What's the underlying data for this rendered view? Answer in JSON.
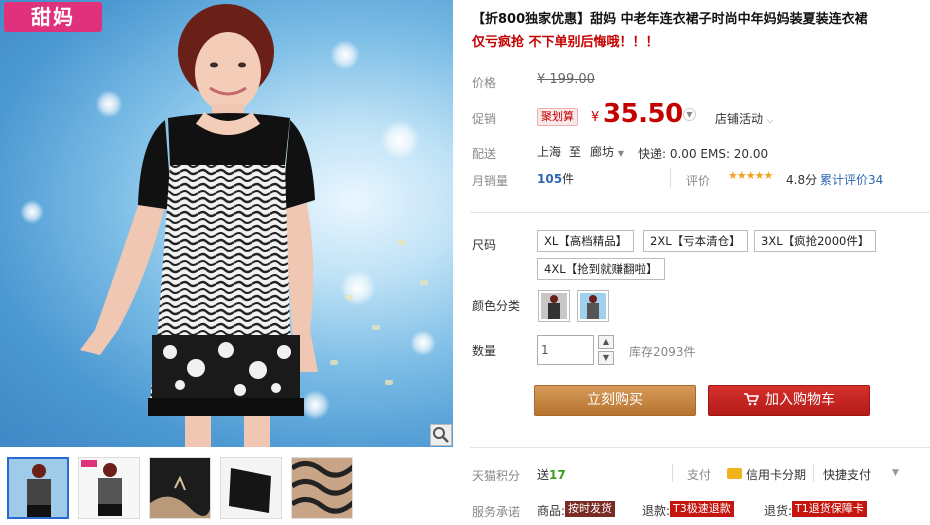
{
  "gallery": {
    "logo_text": "甜妈",
    "thumbnails": [
      "main-front",
      "front-full",
      "fabric-lace",
      "sleeve-detail",
      "zebra-fabric"
    ]
  },
  "product": {
    "title": "【折800独家优惠】甜妈 中老年连衣裙子时尚中年妈妈装夏装连衣裙",
    "subtitle": "仅亏疯抢 不下单别后悔哦！！！"
  },
  "price": {
    "label": "价格",
    "original": "¥ 199.00",
    "promo_label": "促销",
    "promo_badge": "聚划算",
    "currency": "¥",
    "current": "35.50",
    "store_activity": "店铺活动"
  },
  "shipping": {
    "label": "配送",
    "from": "上海",
    "to_word": "至",
    "destination": "廊坊",
    "fees": "快递: 0.00 EMS: 20.00"
  },
  "sales": {
    "label": "月销量",
    "count": "105",
    "unit": "件",
    "rating_label": "评价",
    "stars": "★★★★★",
    "score": "4.8分",
    "total_reviews": "累计评价34"
  },
  "options": {
    "size_label": "尺码",
    "sizes": [
      "XL【高档精品】",
      "2XL【亏本清仓】",
      "3XL【疯抢2000件】",
      "4XL【抢到就赚翻啦】"
    ],
    "color_label": "颜色分类"
  },
  "quantity": {
    "label": "数量",
    "value": "1",
    "up": "▲",
    "down": "▼",
    "stock": "库存2093件"
  },
  "actions": {
    "buy_now": "立刻购买",
    "add_to_cart": "加入购物车"
  },
  "extras": {
    "points_label": "天猫积分",
    "points_prefix": "送",
    "points_value": "17",
    "pay_label": "支付",
    "pay_credit": "信用卡分期",
    "pay_quick": "快捷支付",
    "service_label": "服务承诺",
    "svc1_prefix": "商品:",
    "svc1_tag": "按时发货",
    "svc2_prefix": "退款:",
    "svc2_tag": "T3极速退款",
    "svc3_prefix": "退货:",
    "svc3_tag": "T1退货保障卡"
  },
  "colors": {
    "price_red": "#c40000",
    "buy_button": "#c78642",
    "cart_button": "#c4241f",
    "link_blue": "#2c67b5"
  }
}
